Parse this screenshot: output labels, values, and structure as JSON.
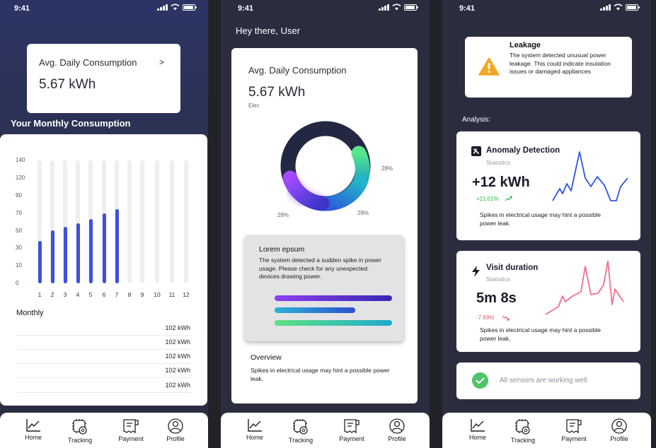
{
  "status": {
    "time": "9:41"
  },
  "nav": [
    {
      "label": "Home",
      "icon": "line-chart-icon"
    },
    {
      "label": "Tracking",
      "icon": "gear-chip-icon"
    },
    {
      "label": "Payment",
      "icon": "receipt-icon"
    },
    {
      "label": "Profile",
      "icon": "profile-icon"
    }
  ],
  "screen1": {
    "avg_title": "Avg. Daily Consumption",
    "avg_chevron": ">",
    "avg_value": "5.67 kWh",
    "monthly_title": "Your Monthly Consumption",
    "chart_data": {
      "type": "bar",
      "categories": [
        "1",
        "2",
        "3",
        "4",
        "5",
        "6",
        "7",
        "8",
        "9",
        "10",
        "11",
        "12"
      ],
      "values": [
        38,
        51,
        55,
        59,
        64,
        70,
        75,
        null,
        null,
        null,
        null,
        null
      ],
      "y_ticks": [
        "0",
        "10",
        "30",
        "50",
        "70",
        "90",
        "120",
        "140"
      ],
      "bar_color": "#3e4fe0"
    },
    "list_title": "Monthly",
    "list_values": [
      "102 kWh",
      "102 kWh",
      "102 kWh",
      "102 kWh",
      "102 kWh"
    ]
  },
  "screen2": {
    "greeting": "Hey there,  User",
    "avg_title": "Avg. Daily Consumption",
    "avg_value": "5.67 kWh",
    "avg_unit": "Elec",
    "donut_labels": [
      "28%",
      "28%",
      "28%"
    ],
    "alert_title": "Lorem epsum",
    "alert_body": "The system detected a sudden spike in power usage. Please check for any unexpected devices drawing power.",
    "overview_title": "Overview",
    "overview_body": "Spikes in electrical usage may hint a possible power leak."
  },
  "screen3": {
    "leak_title": "Leakage",
    "leak_body": "The system detected unusual power leakage. This could indicate insulation issues or damaged appliances",
    "analysis_label": "Analysis:",
    "anomaly": {
      "title": "Anomaly Detection",
      "subtitle": "Statistics",
      "value": "+12 kWh",
      "change": "+21.01%",
      "desc": "Spikes in electrical usage may hint a possible power leak.",
      "color": "#2f55e6"
    },
    "visit": {
      "title": "Visit duration",
      "subtitle": "Statistics",
      "value": "5m 8s",
      "change": "-7.69%",
      "desc": "Spikes in electrical usage may hint a possible power leak.",
      "color": "#f0708a"
    },
    "sensors_text": "All sensors are working well."
  }
}
